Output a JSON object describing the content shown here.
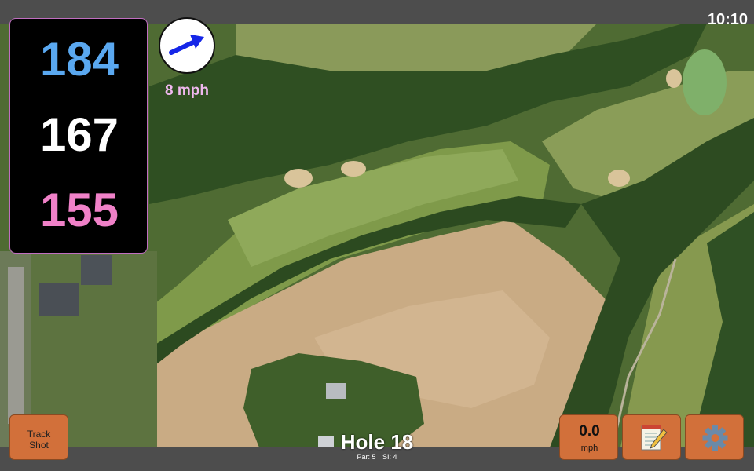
{
  "status": {
    "time": "10:10"
  },
  "distances": {
    "back": "184",
    "middle": "167",
    "front": "155"
  },
  "wind": {
    "speed_label": "8 mph",
    "arrow_icon": "wind-direction-arrow-icon"
  },
  "buttons": {
    "track_shot_line1": "Track",
    "track_shot_line2": "Shot",
    "speed_value": "0.0",
    "speed_unit": "mph",
    "notes_icon": "notepad-icon",
    "settings_icon": "gear-icon"
  },
  "hole": {
    "title": "Hole 18",
    "par_label": "Par: 5",
    "si_label": "SI: 4"
  },
  "colors": {
    "back": "#5aa8f0",
    "middle": "#ffffff",
    "front": "#f081c8",
    "button": "#d2703a",
    "bar": "#4d4d4d"
  }
}
